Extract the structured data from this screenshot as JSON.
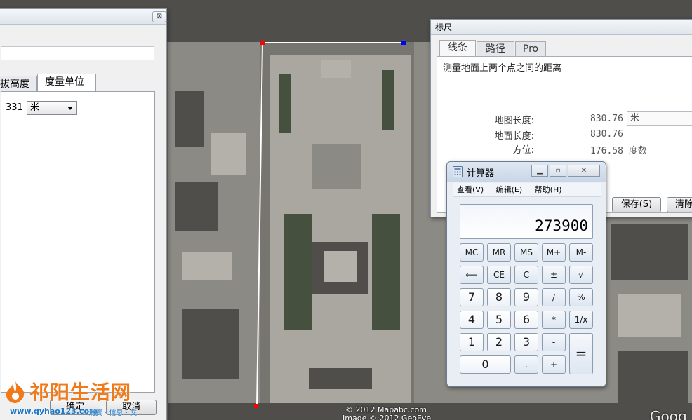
{
  "left_window": {
    "tabs": [
      "拔高度",
      "度量单位"
    ],
    "field_value": "331",
    "unit_select": "米",
    "ok_button": "确定",
    "cancel_button": "取消"
  },
  "ruler_window": {
    "title": "标尺",
    "tabs": [
      "线条",
      "路径",
      "Pro"
    ],
    "description": "测量地面上两个点之间的距离",
    "map_length_label": "地图长度:",
    "map_length_value": "830.76",
    "map_length_unit": "米",
    "ground_length_label": "地面长度:",
    "ground_length_value": "830.76",
    "heading_label": "方位:",
    "heading_value": "176.58 度数",
    "save_button": "保存(S)",
    "clear_button": "清除"
  },
  "calculator": {
    "title": "计算器",
    "menu": [
      "查看(V)",
      "编辑(E)",
      "帮助(H)"
    ],
    "display": "273900",
    "keys": {
      "mc": "MC",
      "mr": "MR",
      "ms": "MS",
      "mplus": "M+",
      "mminus": "M-",
      "back": "⟵",
      "ce": "CE",
      "c": "C",
      "pm": "±",
      "sqrt": "√",
      "k7": "7",
      "k8": "8",
      "k9": "9",
      "div": "/",
      "pct": "%",
      "k4": "4",
      "k5": "5",
      "k6": "6",
      "mul": "*",
      "recip": "1/x",
      "k1": "1",
      "k2": "2",
      "k3": "3",
      "minus": "-",
      "k0": "0",
      "dot": ".",
      "plus": "+",
      "eq": "="
    }
  },
  "map": {
    "copyright_1": "© 2012 Mapabc.com",
    "copyright_2": "Image © 2012 GeoEye",
    "logo": "Goog"
  },
  "watermark": {
    "brand": "祁阳生活网",
    "url": "www.qyhao123.com",
    "tagline": "消费 · 信息 · 交友"
  },
  "colors": {
    "ruler_line": "#ffffff",
    "start_marker": "#ff0000",
    "end_marker": "#0000ff",
    "watermark_orange": "#f07a1a",
    "watermark_blue": "#1b78c8"
  }
}
